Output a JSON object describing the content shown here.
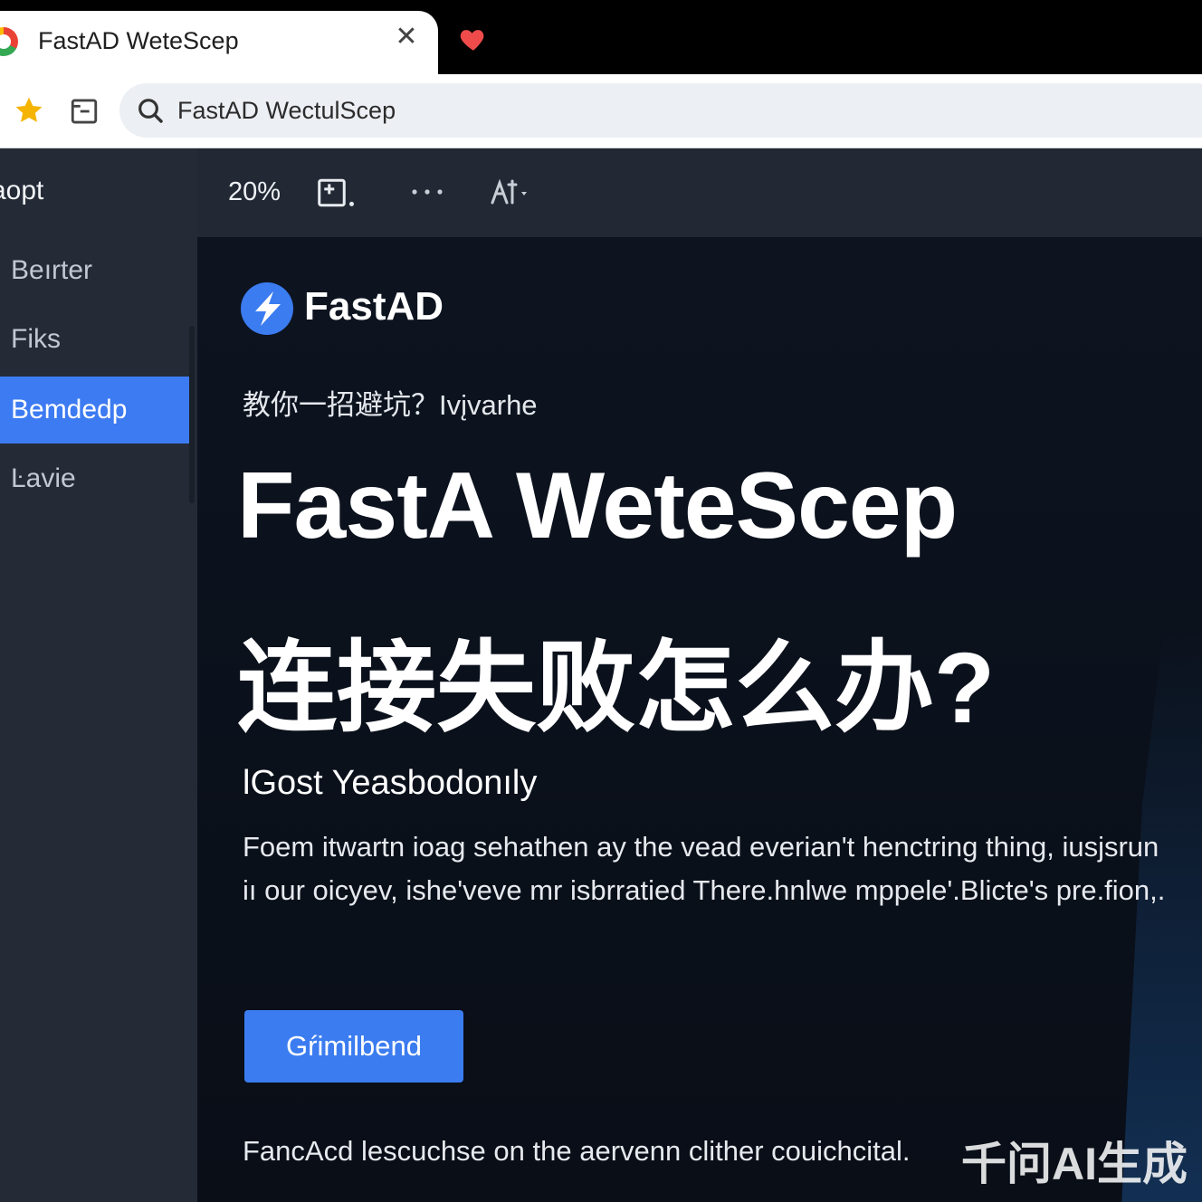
{
  "browser": {
    "tab_title": "FastAD WeteScep",
    "tab_close": "✕",
    "address_text": "FastAD WectulScep"
  },
  "sidebar": {
    "heading": "aopt",
    "items": [
      {
        "label": "Beırter",
        "active": false
      },
      {
        "label": "Fiks",
        "active": false
      },
      {
        "label": "Bemdedp",
        "active": true
      },
      {
        "label": "Ŀavie",
        "active": false
      }
    ]
  },
  "content_toolbar": {
    "zoom": "20%"
  },
  "main": {
    "logo_text": "FastAD",
    "subtitle": "教你一招避坑？Ivįvarhe",
    "headline_1": "FastA WeteScep",
    "headline_2": "连接失败怎么办?",
    "section_heading": "lGost Yeasbodonıly",
    "body": "Foem itwartn ioag sehathen ay the vead everian't henctring thing, iusjsrun iı our oicyev, ishe'veve mr isbrratied There.hnlwe mppele'.Blicte's pre.fion,.",
    "cta_label": "Gŕimilbend",
    "footer": "FancAcd lescuchse on the aervenn clither couichcital."
  },
  "watermark": "千问AI生成",
  "colors": {
    "accent": "#3b7cf0",
    "sidebar_bg": "#242b36",
    "main_bg": "#0d1420"
  },
  "icons": [
    "chrome-favicon",
    "heart-icon",
    "star-icon",
    "reader-icon",
    "search-icon",
    "save-icon",
    "more-icon",
    "share-icon",
    "lightning-logo-icon"
  ]
}
